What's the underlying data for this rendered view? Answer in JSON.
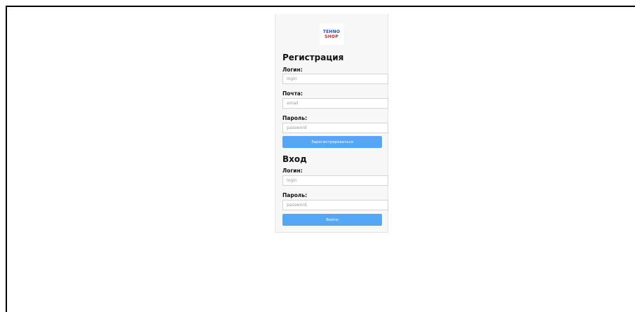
{
  "logo": {
    "line1": "TEHNO",
    "line2": "SHOP"
  },
  "register": {
    "title": "Регистрация",
    "login_label": "Логин:",
    "login_placeholder": "login",
    "email_label": "Почта:",
    "email_placeholder": "email",
    "password_label": "Пароль:",
    "password_placeholder": "password",
    "submit_label": "Зарегистрироваться"
  },
  "login": {
    "title": "Вход",
    "login_label": "Логин:",
    "login_placeholder": "login",
    "password_label": "Пароль:",
    "password_placeholder": "password",
    "submit_label": "Войти"
  },
  "colors": {
    "button": "#55a6f3",
    "card_background": "#f7f7f7",
    "logo_blue": "#1f4fb0",
    "logo_red": "#e0192b"
  }
}
